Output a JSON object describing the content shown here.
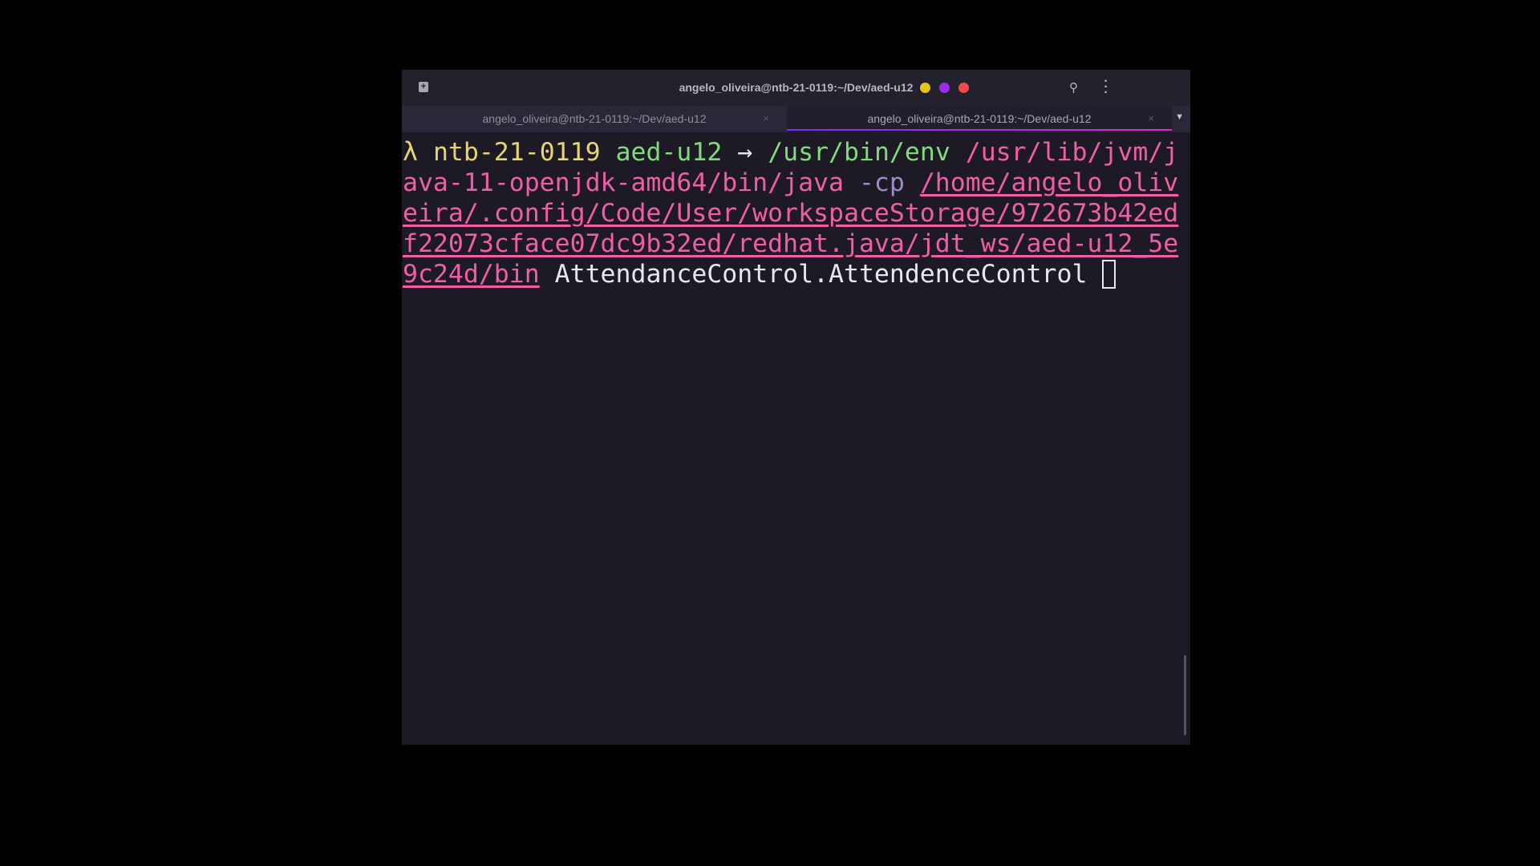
{
  "window": {
    "title": "angelo_oliveira@ntb-21-0119:~/Dev/aed-u12",
    "controls": {
      "minimize_color": "#e5c31a",
      "maximize_color": "#9b2cf0",
      "close_color": "#ef4b4b"
    }
  },
  "tabs": [
    {
      "label": "angelo_oliveira@ntb-21-0119:~/Dev/aed-u12",
      "close": "×",
      "active": false
    },
    {
      "label": "angelo_oliveira@ntb-21-0119:~/Dev/aed-u12",
      "close": "×",
      "active": true
    }
  ],
  "terminal": {
    "prompt_symbol": "λ",
    "host": "ntb-21-0119",
    "dir": "aed-u12",
    "arrow": "→",
    "cmd": "/usr/bin/env",
    "java_path_1": "/usr/lib/jvm/j",
    "java_path_2": "ava-11-openjdk-amd64/bin/java",
    "flag": "-cp",
    "cp_1": "/home/angelo_oliv",
    "cp_2": "eira/.config/Code/User/workspaceStorage/972673b42ed",
    "cp_3": "f22073cface07dc9b32ed/redhat.java/jdt_ws/aed-u12_5e",
    "cp_4": "9c24d/bin",
    "main_class": "AttendanceControl.AttendenceControl"
  }
}
